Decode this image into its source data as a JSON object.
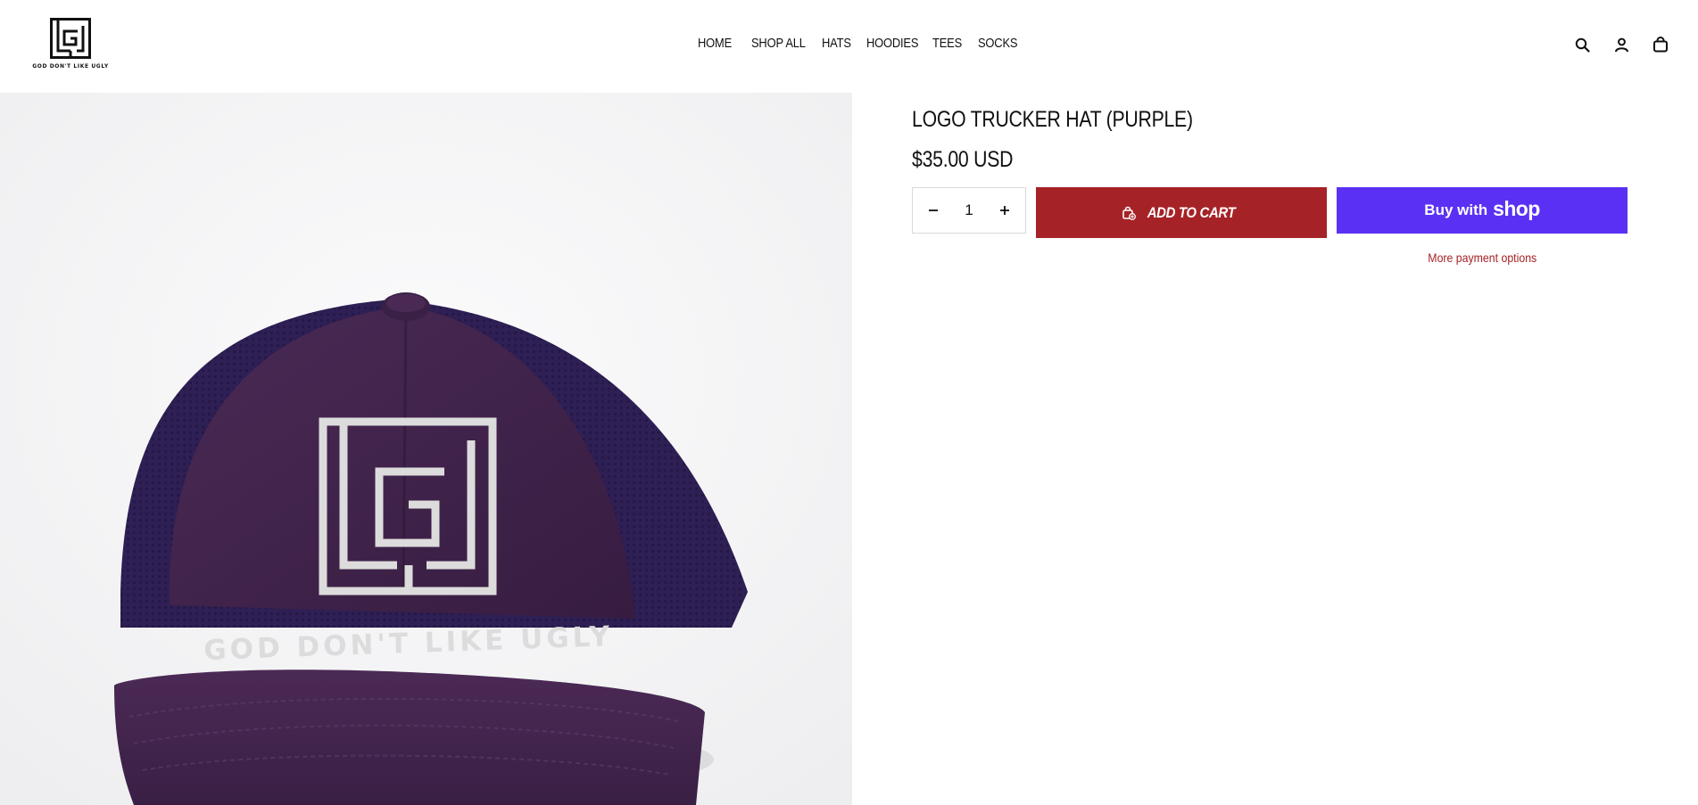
{
  "brand": {
    "logo_text": "GOD DON'T LIKE UGLY"
  },
  "nav": {
    "items": [
      {
        "label": "HOME"
      },
      {
        "label": "SHOP ALL"
      },
      {
        "label": "HATS"
      },
      {
        "label": "HOODIES"
      },
      {
        "label": "TEES"
      },
      {
        "label": "SOCKS"
      }
    ]
  },
  "header_icons": [
    "search-icon",
    "account-icon",
    "cart-icon"
  ],
  "product": {
    "title": "LOGO TRUCKER HAT (PURPLE)",
    "price": "$35.00 USD",
    "quantity": "1",
    "image_text": "GOD DON'T LIKE UGLY",
    "colors": {
      "hat_crown": "#3f2249",
      "hat_mesh": "#2e1f54",
      "embroidery": "#dcdcdc"
    }
  },
  "actions": {
    "add_to_cart": "ADD TO CART",
    "buy_with": "Buy with",
    "shop_word": "shop",
    "more_payment": "More payment options"
  },
  "colors": {
    "add_to_cart_bg": "#a52226",
    "shop_pay_bg": "#5a31f4"
  }
}
